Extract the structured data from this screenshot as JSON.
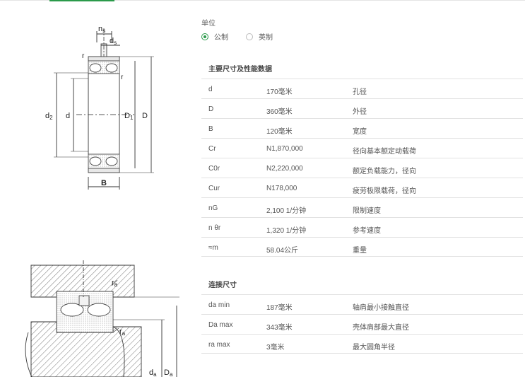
{
  "units": {
    "label": "单位",
    "options": [
      {
        "label": "公制",
        "selected": true
      },
      {
        "label": "英制",
        "selected": false
      }
    ]
  },
  "main_dims": {
    "title": "主要尺寸及性能数据",
    "rows": [
      {
        "symbol": "d",
        "value": "170毫米",
        "desc": "孔径"
      },
      {
        "symbol": "D",
        "value": "360毫米",
        "desc": "外径"
      },
      {
        "symbol": "B",
        "value": "120毫米",
        "desc": "宽度"
      },
      {
        "symbol": "Cr",
        "value": "N1,870,000",
        "desc": "径向基本额定动载荷"
      },
      {
        "symbol": "C0r",
        "value": "N2,220,000",
        "desc": "额定负载能力，径向"
      },
      {
        "symbol": "Cur",
        "value": "N178,000",
        "desc": "疲劳极限载荷，径向"
      },
      {
        "symbol": "nG",
        "value": "2,100 1/分钟",
        "desc": "限制速度"
      },
      {
        "symbol": "n θr",
        "value": "1,320 1/分钟",
        "desc": "参考速度"
      },
      {
        "symbol": "≈m",
        "value": "58.04公斤",
        "desc": "重量"
      }
    ]
  },
  "mounting_dims": {
    "title": "连接尺寸",
    "rows": [
      {
        "symbol": "da min",
        "value": "187毫米",
        "desc": "轴肩最小接触直径"
      },
      {
        "symbol": "Da max",
        "value": "343毫米",
        "desc": "壳体肩部最大直径"
      },
      {
        "symbol": "ra max",
        "value": "3毫米",
        "desc": "最大圆角半径"
      }
    ]
  },
  "drawing": {
    "labels": {
      "ns": "n",
      "ns_sub": "s",
      "ds": "d",
      "ds_sub": "s",
      "r_top": "r",
      "r_right": "r",
      "d2": "d",
      "d2_sub": "2",
      "d": "d",
      "D1": "D",
      "D1_sub": "1",
      "D": "D",
      "B": "B",
      "ra_top": "r",
      "ra_top_sub": "a",
      "ra_bottom": "r",
      "ra_bottom_sub": "a",
      "da": "d",
      "da_sub": "a",
      "Da": "D",
      "Da_sub": "a"
    }
  }
}
